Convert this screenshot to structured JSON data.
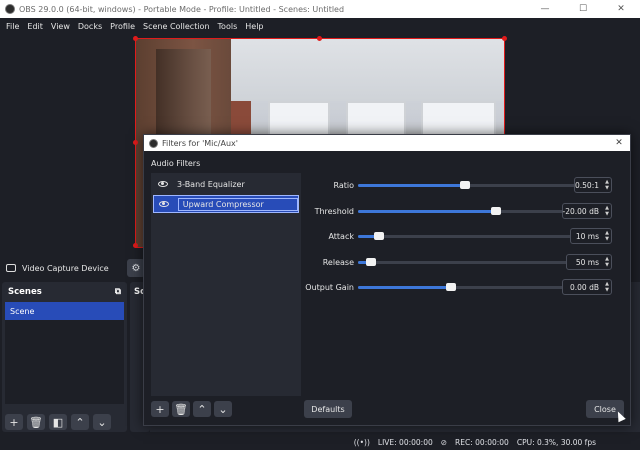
{
  "window": {
    "title": "OBS 29.0.0 (64-bit, windows) - Portable Mode - Profile: Untitled - Scenes: Untitled",
    "minimize": "—",
    "maximize": "☐",
    "close": "✕"
  },
  "menu": [
    "File",
    "Edit",
    "View",
    "Docks",
    "Profile",
    "Scene Collection",
    "Tools",
    "Help"
  ],
  "source_bar": {
    "source_name": "Video Capture Device",
    "gear_icon": "gear-icon"
  },
  "scenes_dock": {
    "title": "Scenes",
    "items": [
      "Scene"
    ]
  },
  "sources_dock": {
    "title_partial": "So"
  },
  "status": {
    "live": "LIVE: 00:00:00",
    "rec": "REC: 00:00:00",
    "cpu": "CPU: 0.3%, 30.00 fps"
  },
  "dialog": {
    "title": "Filters for 'Mic/Aux'",
    "section_label": "Audio Filters",
    "filters": [
      {
        "label": "3-Band Equalizer",
        "selected": false
      },
      {
        "label": "Upward Compressor",
        "selected": true
      }
    ],
    "properties": [
      {
        "label": "Ratio",
        "value": "0.50:1",
        "fraction": 0.49
      },
      {
        "label": "Threshold",
        "value": "-20.00 dB",
        "fraction": 0.67
      },
      {
        "label": "Attack",
        "value": "10 ms",
        "fraction": 0.1
      },
      {
        "label": "Release",
        "value": "50 ms",
        "fraction": 0.06
      },
      {
        "label": "Output Gain",
        "value": "0.00 dB",
        "fraction": 0.45
      }
    ],
    "defaults_label": "Defaults",
    "close_label": "Close"
  },
  "colors": {
    "accent": "#284cb8",
    "slider_fill": "#3d77d9",
    "selection_border": "#e01b1b"
  }
}
